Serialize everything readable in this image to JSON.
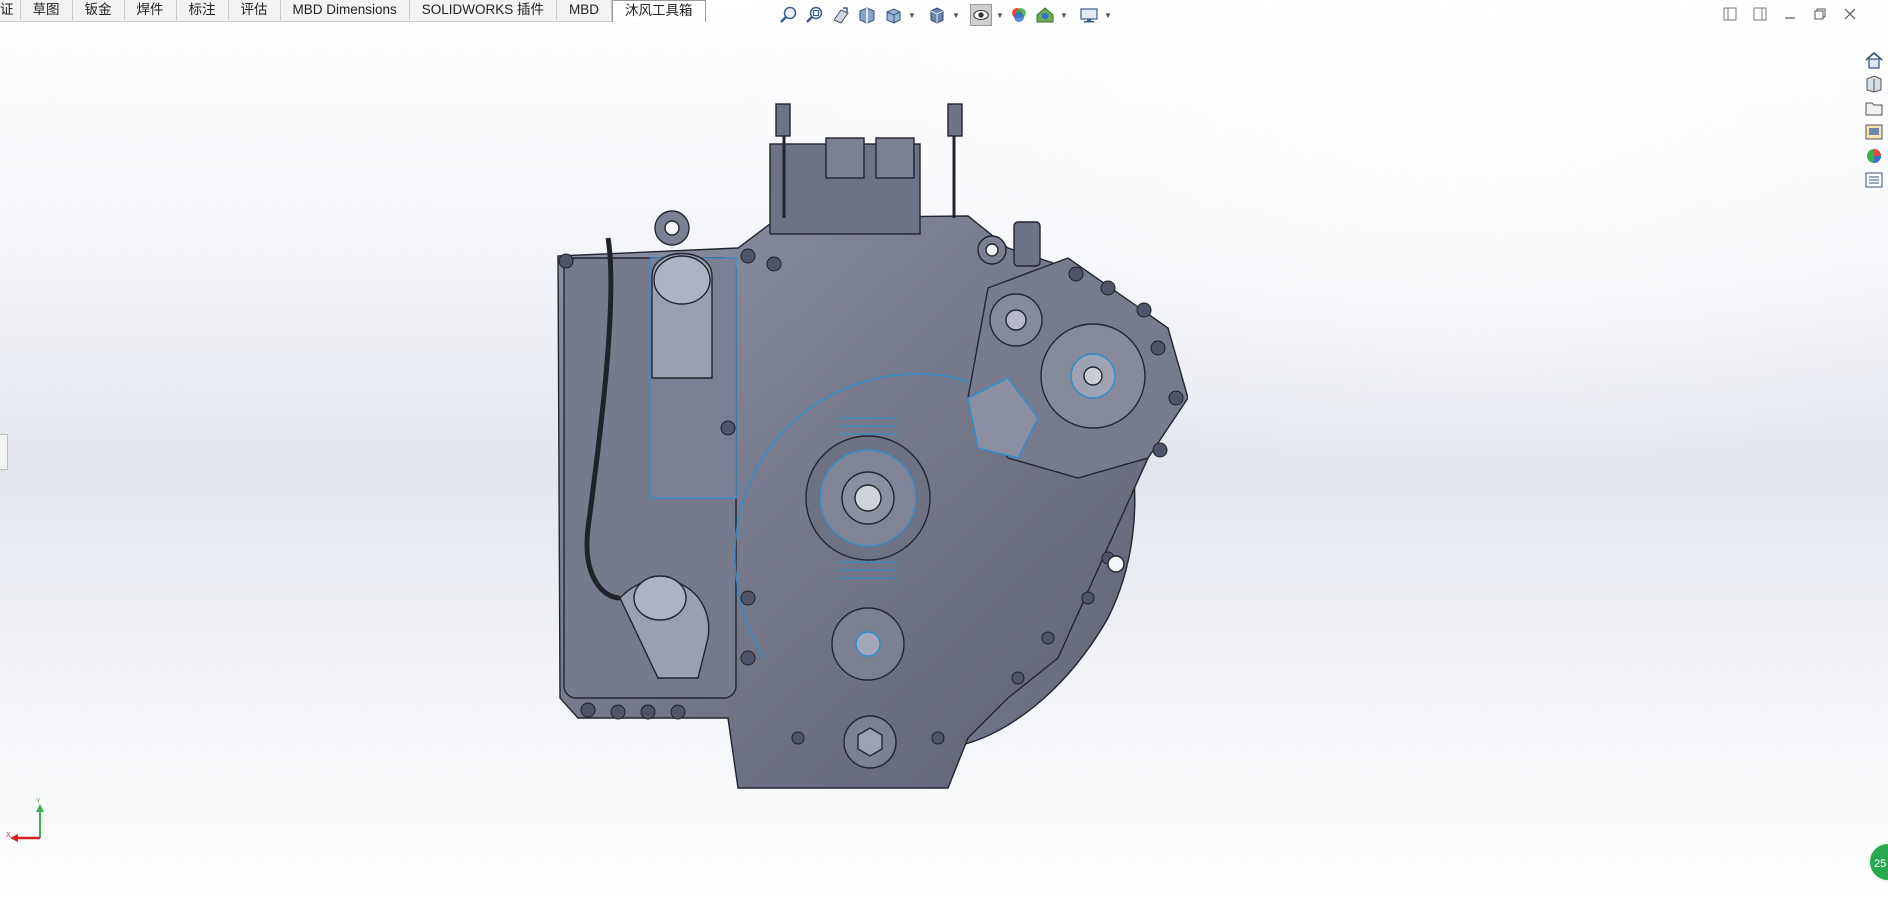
{
  "command_manager": {
    "tabs": [
      {
        "label": "证"
      },
      {
        "label": "草图"
      },
      {
        "label": "钣金"
      },
      {
        "label": "焊件"
      },
      {
        "label": "标注"
      },
      {
        "label": "评估"
      },
      {
        "label": "MBD Dimensions"
      },
      {
        "label": "SOLIDWORKS 插件"
      },
      {
        "label": "MBD"
      },
      {
        "label": "沐风工具箱"
      }
    ],
    "active_tab": "沐风工具箱"
  },
  "heads_up_toolbar": {
    "icons": [
      "zoom-to-fit-icon",
      "zoom-to-area-icon",
      "previous-view-icon",
      "section-view-icon",
      "view-orientation-icon",
      "display-style-icon",
      "hide-show-items-icon",
      "edit-appearance-icon",
      "apply-scene-icon",
      "view-settings-icon"
    ]
  },
  "task_pane": {
    "icons": [
      "home-icon",
      "design-library-icon",
      "file-explorer-icon",
      "view-palette-icon",
      "appearances-icon",
      "custom-properties-icon"
    ]
  },
  "triad": {
    "x_label": "X",
    "y_label": "Y"
  },
  "status": {
    "rebuild_badge": "25"
  },
  "colors": {
    "model_fill": "#6f7486",
    "edge_highlight": "#2d8fcf",
    "accent": "#2aa84f"
  }
}
